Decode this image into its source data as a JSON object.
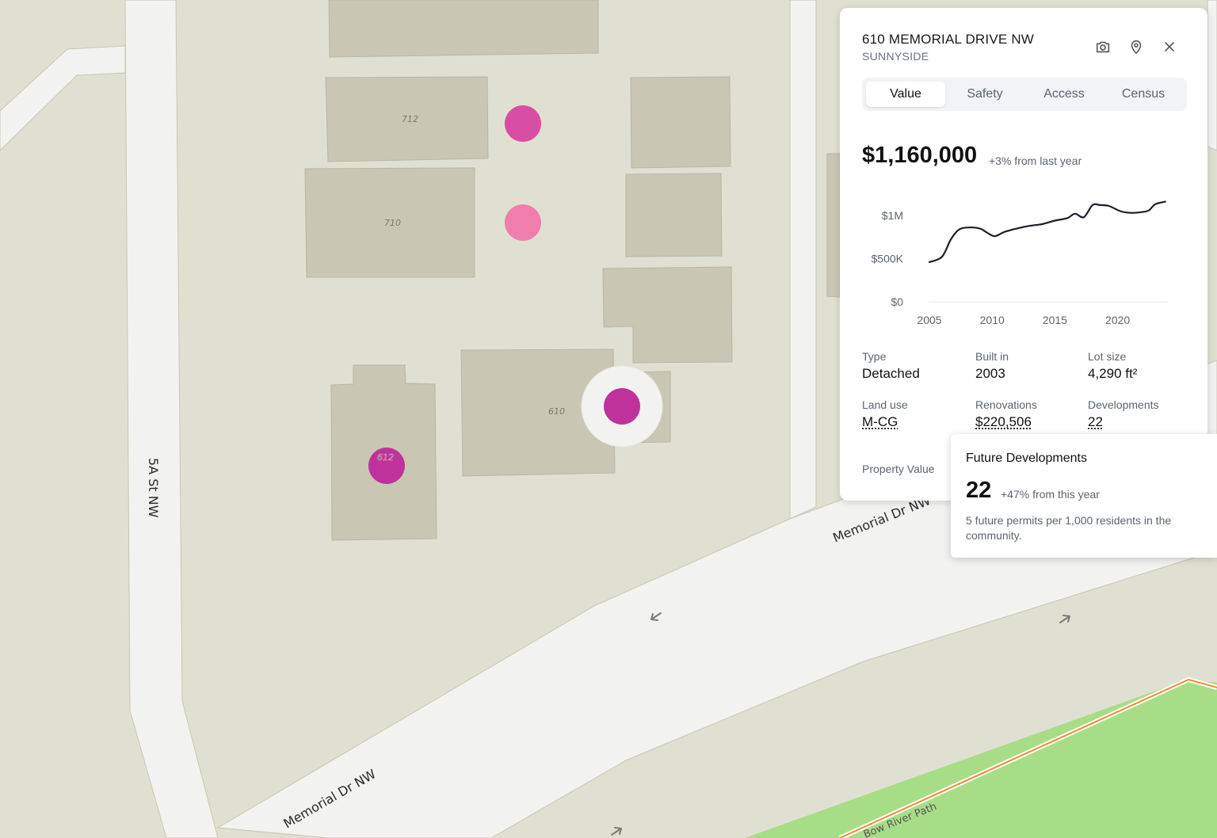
{
  "map": {
    "lot_labels": [
      "712",
      "710",
      "610",
      "612"
    ],
    "street_labels": {
      "fifth_a_st": "5A St NW",
      "memorial_upper": "Memorial Dr NW",
      "memorial_lower": "Memorial Dr NW",
      "bow_river_path": "Bow River Path"
    },
    "colors": {
      "land": "#e0e0d2",
      "building": "#c9c7b4",
      "road": "#f2f2f0",
      "park": "#a8dd88",
      "path": "#f08a2e",
      "marker_magenta": "#c0329b",
      "marker_pink": "#d84ea5",
      "marker_light_pink": "#f07ead"
    },
    "icons": [
      "direction-arrow-icon"
    ]
  },
  "panel": {
    "address": "610 MEMORIAL DRIVE NW",
    "neighborhood": "SUNNYSIDE",
    "icons": [
      "camera-icon",
      "map-pin-icon",
      "close-icon"
    ],
    "tabs": [
      {
        "label": "Value",
        "active": true
      },
      {
        "label": "Safety",
        "active": false
      },
      {
        "label": "Access",
        "active": false
      },
      {
        "label": "Census",
        "active": false
      }
    ],
    "price": "$1,160,000",
    "price_change": "+3% from last year",
    "stats": [
      {
        "label": "Type",
        "value": "Detached"
      },
      {
        "label": "Built in",
        "value": "2003"
      },
      {
        "label": "Lot size",
        "value": "4,290 ft²"
      },
      {
        "label": "Land use",
        "value": "M-CG"
      },
      {
        "label": "Renovations",
        "value": "$220,506"
      },
      {
        "label": "Developments",
        "value": "22"
      }
    ],
    "property_value_label": "Property Value"
  },
  "chart_data": {
    "type": "line",
    "title": "",
    "xlabel": "",
    "ylabel": "",
    "x_ticks": [
      "2005",
      "2010",
      "2015",
      "2020"
    ],
    "y_ticks": [
      "$0",
      "$500K",
      "$1M"
    ],
    "xlim": [
      2005,
      2024
    ],
    "ylim": [
      0,
      1000000
    ],
    "grid": false,
    "line_color": "#1a1f2b",
    "x": [
      2005,
      2006,
      2006.7,
      2007.3,
      2008,
      2009,
      2009.6,
      2010.2,
      2011,
      2012,
      2013,
      2014,
      2015,
      2016,
      2016.6,
      2017.3,
      2018,
      2018.6,
      2019.3,
      2020.2,
      2021,
      2022,
      2022.5,
      2023,
      2023.8
    ],
    "y": [
      460000,
      520000,
      720000,
      830000,
      860000,
      850000,
      800000,
      760000,
      810000,
      850000,
      880000,
      900000,
      940000,
      970000,
      1020000,
      980000,
      1120000,
      1120000,
      1110000,
      1050000,
      1030000,
      1040000,
      1060000,
      1130000,
      1160000
    ]
  },
  "tooltip": {
    "title": "Future Developments",
    "value": "22",
    "change": "+47% from this year",
    "description": "5 future permits per 1,000 residents in the community."
  }
}
